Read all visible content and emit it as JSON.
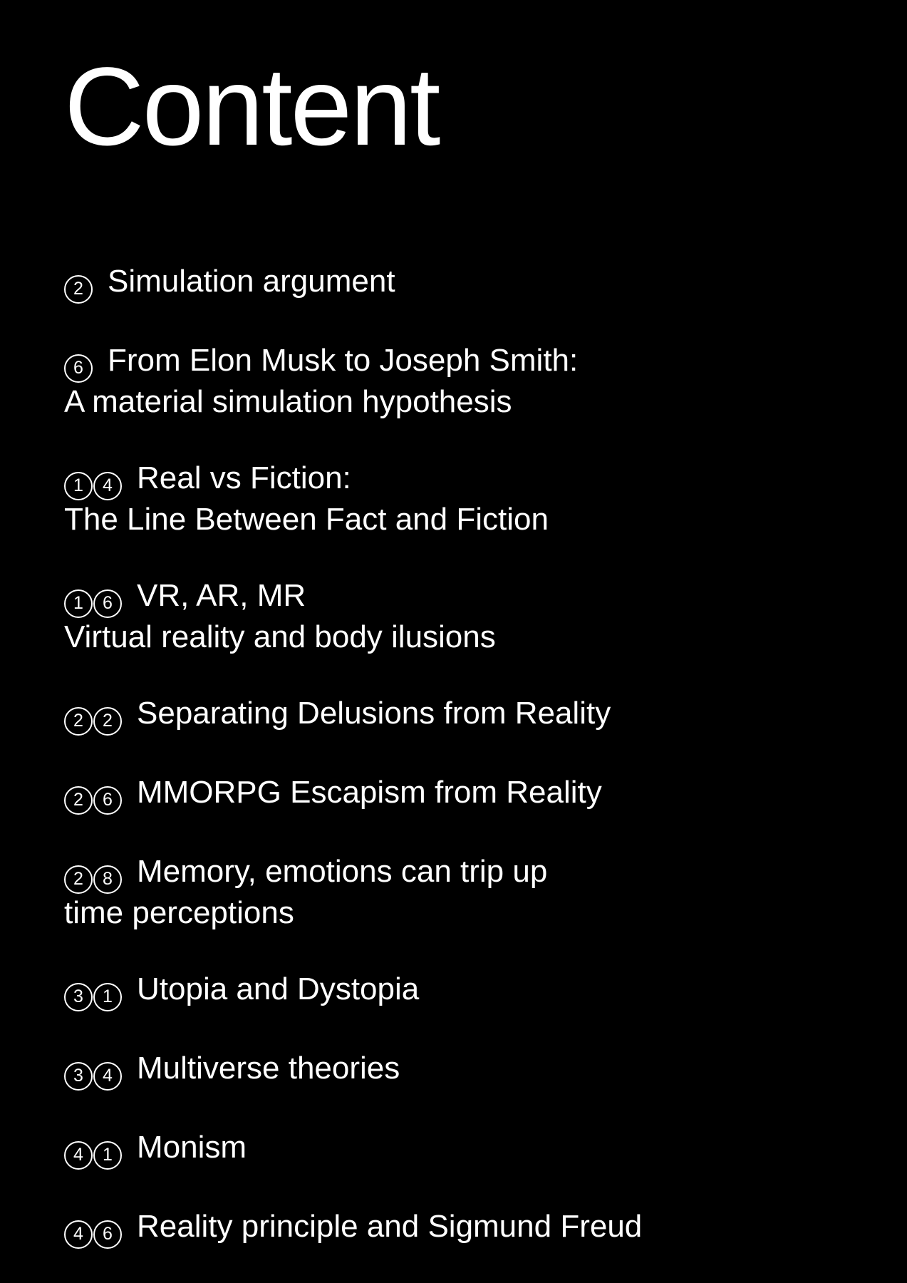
{
  "title": "Content",
  "items": [
    {
      "number": "2",
      "lines": [
        "Simulation argument"
      ]
    },
    {
      "number": "6",
      "lines": [
        "From Elon Musk to Joseph Smith:",
        "A material simulation hypothesis"
      ]
    },
    {
      "number": "14",
      "lines": [
        "Real vs Fiction:",
        "The Line Between Fact and Fiction"
      ]
    },
    {
      "number": "16",
      "lines": [
        "VR, AR, MR",
        "Virtual reality and body ilusions"
      ]
    },
    {
      "number": "22",
      "lines": [
        "Separating Delusions from Reality"
      ]
    },
    {
      "number": "26",
      "lines": [
        "MMORPG Escapism from Reality"
      ]
    },
    {
      "number": "28",
      "lines": [
        "Memory, emotions can trip up",
        "time perceptions"
      ]
    },
    {
      "number": "31",
      "lines": [
        "Utopia and Dystopia"
      ]
    },
    {
      "number": "34",
      "lines": [
        "Multiverse theories"
      ]
    },
    {
      "number": "41",
      "lines": [
        "Monism"
      ]
    },
    {
      "number": "46",
      "lines": [
        "Reality principle and Sigmund Freud"
      ]
    }
  ],
  "colors": {
    "background": "#000000",
    "text": "#ffffff"
  }
}
